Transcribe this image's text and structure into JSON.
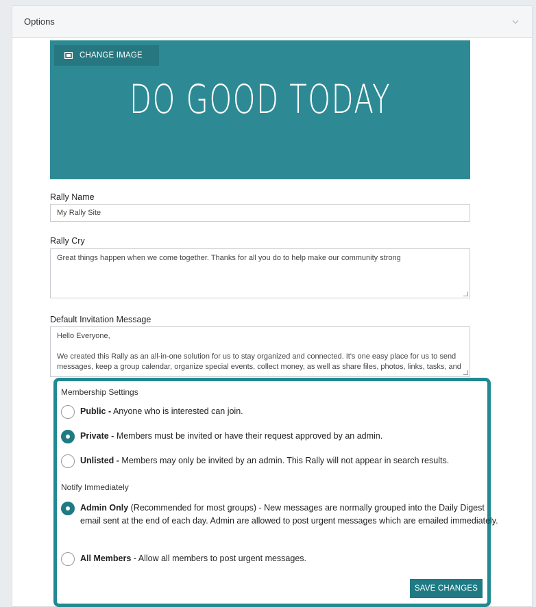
{
  "panel": {
    "title": "Options",
    "toggle_icon": "chevron-down-icon"
  },
  "banner": {
    "change_button_label": "CHANGE IMAGE",
    "change_button_icon": "image-icon",
    "image_text": "DO GOOD TODAY",
    "background_color": "#2d8a94"
  },
  "rally_name": {
    "label": "Rally Name",
    "value": "My Rally Site"
  },
  "rally_cry": {
    "label": "Rally Cry",
    "value": "Great things happen when we come together. Thanks for all you do to help make our community strong"
  },
  "invitation": {
    "label": "Default Invitation Message",
    "value": "Hello Everyone,\n\nWe created this Rally as an all-in-one solution for us to stay organized and connected. It's one easy place for us to send messages, keep a group calendar, organize special events, collect money, as well as share files, photos, links, tasks, and more."
  },
  "membership": {
    "title": "Membership Settings",
    "options": [
      {
        "strong": "Public -",
        "text": " Anyone who is interested can join.",
        "selected": false
      },
      {
        "strong": "Private -",
        "text": " Members must be invited or have their request approved by an admin.",
        "selected": true
      },
      {
        "strong": "Unlisted -",
        "text": " Members may only be invited by an admin. This Rally will not appear in search results.",
        "selected": false
      }
    ]
  },
  "notify": {
    "title": "Notify Immediately",
    "options": [
      {
        "strong": "Admin Only",
        "text": " (Recommended for most groups) - New messages are normally grouped into the Daily Digest email sent at the end of each day. Admin are allowed to post urgent messages which are emailed immediately.",
        "selected": true
      },
      {
        "strong": "All Members",
        "text": " - Allow all members to post urgent messages.",
        "selected": false
      }
    ]
  },
  "save_button_label": "SAVE CHANGES",
  "colors": {
    "accent": "#1f7a84",
    "highlight_border": "#1f8a92",
    "page_bg": "#e9ecef"
  }
}
